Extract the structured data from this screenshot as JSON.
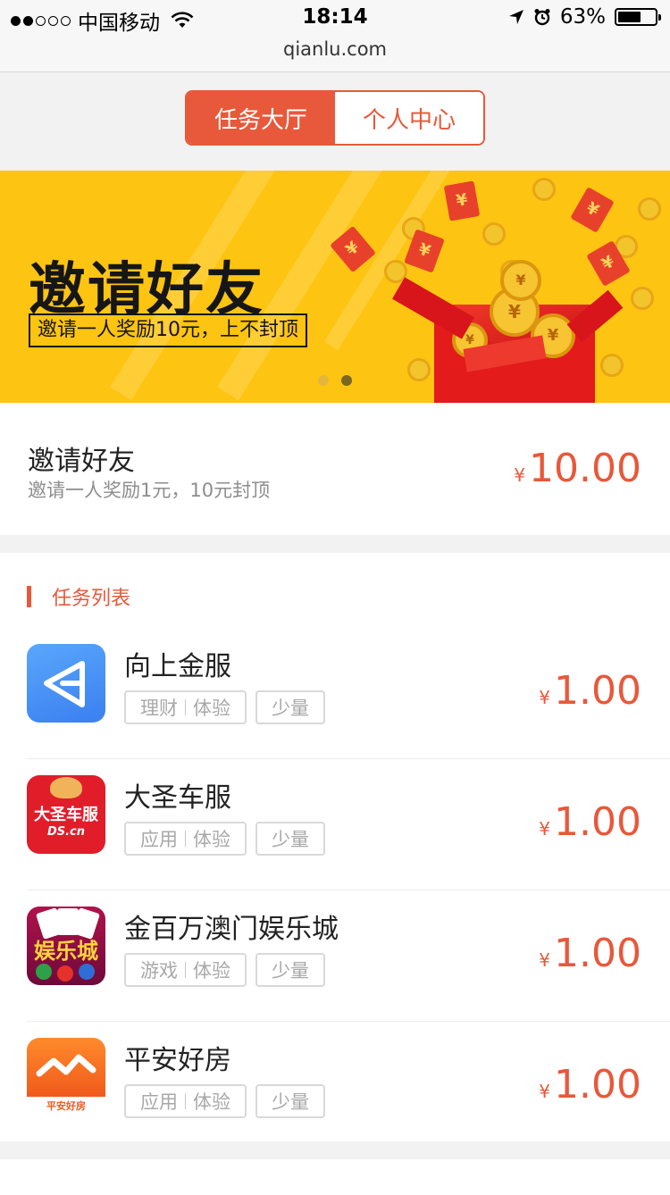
{
  "status_bar": {
    "carrier": "中国移动",
    "time": "18:14",
    "battery": "63%",
    "signal_bars_filled": 2,
    "signal_bars_total": 5
  },
  "url": "qianlu.com",
  "tabs": [
    {
      "label": "任务大厅",
      "active": true
    },
    {
      "label": "个人中心",
      "active": false
    }
  ],
  "banner": {
    "title": "邀请好友",
    "subtitle": "邀请一人奖励10元，上不封顶",
    "page_count": 2,
    "active_page": 2
  },
  "invite": {
    "title": "邀请好友",
    "desc": "邀请一人奖励1元，10元封顶",
    "currency": "¥",
    "amount": "10.00"
  },
  "task_section": {
    "title": "任务列表"
  },
  "tasks": [
    {
      "name": "向上金服",
      "tag1a": "理财",
      "tag1b": "体验",
      "tag2": "少量",
      "currency": "¥",
      "amount": "1.00",
      "icon": "paper-plane-icon"
    },
    {
      "name": "大圣车服",
      "tag1a": "应用",
      "tag1b": "体验",
      "tag2": "少量",
      "currency": "¥",
      "amount": "1.00",
      "icon": "dasheng-logo-icon",
      "icon_text": "大圣车服",
      "icon_subtext": "DS.cn"
    },
    {
      "name": "金百万澳门娱乐城",
      "tag1a": "游戏",
      "tag1b": "体验",
      "tag2": "少量",
      "currency": "¥",
      "amount": "1.00",
      "icon": "casino-logo-icon",
      "icon_text": "娱乐城"
    },
    {
      "name": "平安好房",
      "tag1a": "应用",
      "tag1b": "体验",
      "tag2": "少量",
      "currency": "¥",
      "amount": "1.00",
      "icon": "house-logo-icon",
      "icon_text": "平安好房"
    }
  ],
  "colors": {
    "accent": "#e8583a",
    "banner_bg": "#fdc412",
    "tag_border": "#d9d9d9"
  }
}
